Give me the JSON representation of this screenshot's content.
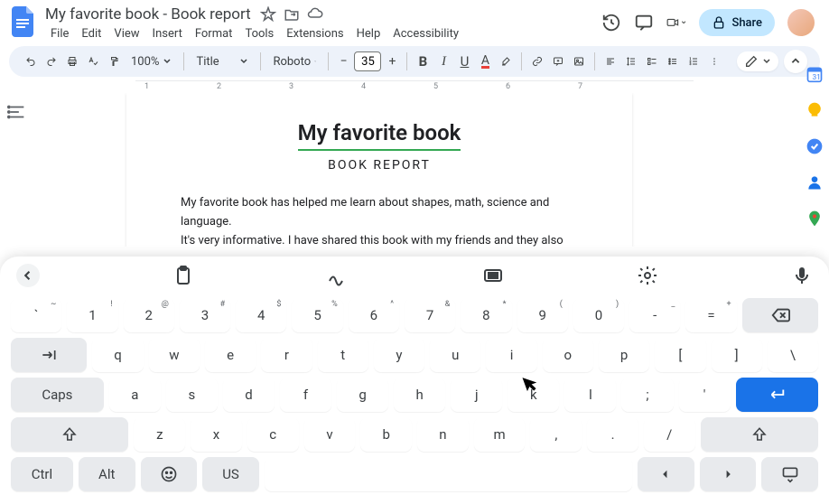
{
  "header": {
    "title": "My favorite book - Book report",
    "menus": [
      "File",
      "Edit",
      "View",
      "Insert",
      "Format",
      "Tools",
      "Extensions",
      "Help",
      "Accessibility"
    ],
    "share": "Share"
  },
  "toolbar": {
    "zoom": "100%",
    "styleSelect": "Title",
    "fontSelect": "Roboto",
    "fontSize": "35"
  },
  "ruler": {
    "n1": "1",
    "n2": "2",
    "n3": "3",
    "n4": "4",
    "n5": "5",
    "n6": "6",
    "n7": "7"
  },
  "doc": {
    "title": "My favorite book",
    "subtitle": "BOOK REPORT",
    "para1": "My favorite book has helped me learn about shapes, math, science and language.",
    "para2": "It's very informative. I have shared this book with my friends and they also enjoyed reading"
  },
  "kb": {
    "row1": [
      {
        "main": "`",
        "sup": "~"
      },
      {
        "main": "1",
        "sup": "!"
      },
      {
        "main": "2",
        "sup": "@"
      },
      {
        "main": "3",
        "sup": "#"
      },
      {
        "main": "4",
        "sup": "$"
      },
      {
        "main": "5",
        "sup": "%"
      },
      {
        "main": "6",
        "sup": "^"
      },
      {
        "main": "7",
        "sup": "&"
      },
      {
        "main": "8",
        "sup": "*"
      },
      {
        "main": "9",
        "sup": "("
      },
      {
        "main": "0",
        "sup": ")"
      },
      {
        "main": "-",
        "sup": "_"
      },
      {
        "main": "=",
        "sup": "+"
      }
    ],
    "row2": [
      "q",
      "w",
      "e",
      "r",
      "t",
      "y",
      "u",
      "i",
      "o",
      "p",
      "[",
      "]",
      "\\"
    ],
    "row3": {
      "caps": "Caps",
      "keys": [
        "a",
        "s",
        "d",
        "f",
        "g",
        "h",
        "j",
        "k",
        "l",
        ";",
        "'"
      ]
    },
    "row4": [
      "z",
      "x",
      "c",
      "v",
      "b",
      "n",
      "m",
      ",",
      ".",
      "/"
    ],
    "row5": {
      "ctrl": "Ctrl",
      "alt": "Alt",
      "us": "US"
    }
  }
}
